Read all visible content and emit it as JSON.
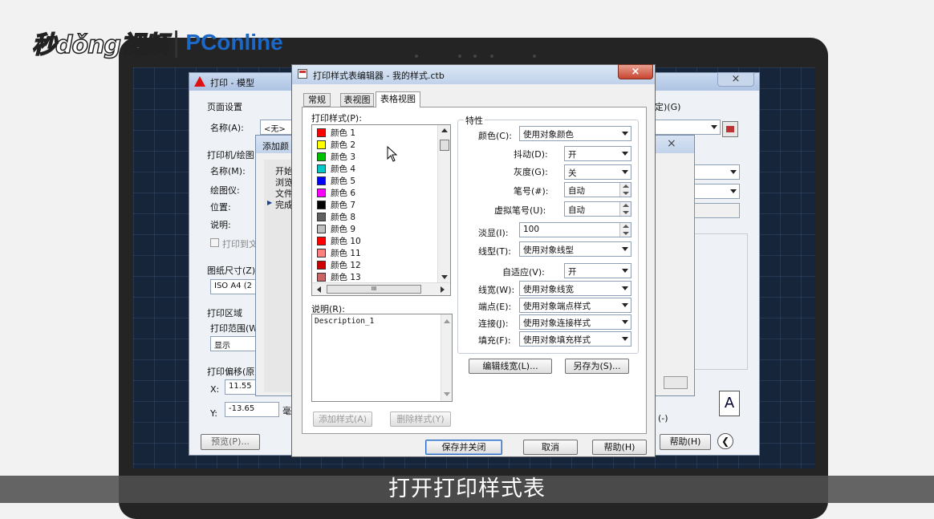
{
  "watermark": {
    "brand_left": "秒dǒng视频",
    "separator": "|",
    "brand_right": "PConline"
  },
  "print_dialog": {
    "title": "打印 - 模型",
    "close": "×",
    "page_setup_label": "页面设置",
    "name_label": "名称(A):",
    "name_value": "<无>",
    "printer_section": "打印机/绘图",
    "printer_name_label": "名称(M):",
    "plotter_label": "绘图仪:",
    "location_label": "位置:",
    "description_label": "说明:",
    "print_to_file_label": "打印到文",
    "paper_size_label": "图纸尺寸(Z)",
    "paper_size_value": "ISO A4 (2",
    "plot_area_label": "打印区域",
    "plot_range_label": "打印范围(W",
    "plot_range_value": "显示",
    "plot_offset_label": "打印偏移(原",
    "x_label": "X:",
    "x_value": "11.55",
    "y_label": "Y:",
    "y_value": "-13.65",
    "y_unit": "毫",
    "preview_button": "预览(P)...",
    "help_button": "帮助(H)",
    "top_right_label": "定)(G)",
    "mm_suffix": "(-)"
  },
  "add_plotstyle_wizard": {
    "title": "添加颜",
    "close": "×",
    "steps": [
      "开始",
      "浏览",
      "文件",
      "完成"
    ]
  },
  "plotstyle_editor": {
    "title": "打印样式表编辑器 - 我的样式.ctb",
    "close": "×",
    "tabs": [
      "常规",
      "表视图",
      "表格视图"
    ],
    "styles_label": "打印样式(P):",
    "styles": [
      {
        "name": "颜色  1",
        "color": "#ff0000"
      },
      {
        "name": "颜色  2",
        "color": "#ffff00"
      },
      {
        "name": "颜色  3",
        "color": "#00c000"
      },
      {
        "name": "颜色  4",
        "color": "#00c8c8"
      },
      {
        "name": "颜色  5",
        "color": "#0000ff"
      },
      {
        "name": "颜色  6",
        "color": "#ff00ff"
      },
      {
        "name": "颜色  7",
        "color": "#000000"
      },
      {
        "name": "颜色  8",
        "color": "#606060"
      },
      {
        "name": "颜色  9",
        "color": "#c0c0c0"
      },
      {
        "name": "颜色  10",
        "color": "#ff0000"
      },
      {
        "name": "颜色  11",
        "color": "#ff8080"
      },
      {
        "name": "颜色  12",
        "color": "#cc0000"
      },
      {
        "name": "颜色  13",
        "color": "#cc6666"
      }
    ],
    "scroll_mid_label": "III",
    "description_label": "说明(R):",
    "description_value": "Description_1",
    "add_style_button": "添加样式(A)",
    "delete_style_button": "删除样式(Y)",
    "properties_label": "特性",
    "properties": {
      "color_label": "颜色(C):",
      "color_value": "使用对象颜色",
      "dither_label": "抖动(D):",
      "dither_value": "开",
      "grayscale_label": "灰度(G):",
      "grayscale_value": "关",
      "pen_label": "笔号(#):",
      "pen_value": "自动",
      "virtual_pen_label": "虚拟笔号(U):",
      "virtual_pen_value": "自动",
      "screening_label": "淡显(I):",
      "screening_value": "100",
      "linetype_label": "线型(T):",
      "linetype_value": "使用对象线型",
      "adaptive_label": "自适应(V):",
      "adaptive_value": "开",
      "lineweight_label": "线宽(W):",
      "lineweight_value": "使用对象线宽",
      "endstyle_label": "端点(E):",
      "endstyle_value": "使用对象端点样式",
      "joinstyle_label": "连接(J):",
      "joinstyle_value": "使用对象连接样式",
      "fillstyle_label": "填充(F):",
      "fillstyle_value": "使用对象填充样式"
    },
    "edit_lineweights_button": "编辑线宽(L)...",
    "save_as_button": "另存为(S)...",
    "save_close_button": "保存并关闭",
    "cancel_button": "取消",
    "help_button": "帮助(H)"
  },
  "subtitle": "打开打印样式表"
}
